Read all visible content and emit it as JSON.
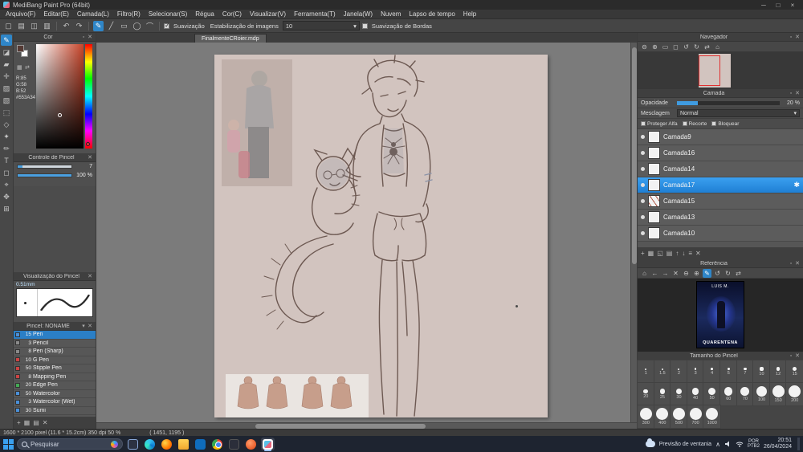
{
  "window": {
    "title": "MediBang Paint Pro (64bit)"
  },
  "menubar": [
    "Arquivo(F)",
    "Editar(E)",
    "Camada(L)",
    "Filtro(R)",
    "Selecionar(S)",
    "Régua",
    "Cor(C)",
    "Visualizar(V)",
    "Ferramenta(T)",
    "Janela(W)",
    "Nuvem",
    "Lapso de tempo",
    "Help"
  ],
  "toolbar": {
    "smoothing": "Suavização",
    "stabilization_label": "Estabilização de imagens",
    "stabilization_value": "10",
    "edge_smoothing": "Suavização de Bordas"
  },
  "color_panel": {
    "title": "Cor",
    "r": "R:85",
    "g": "G:58",
    "b": "B:52",
    "hex": "#553A34",
    "foreground": "#553A34",
    "background": "#FFFFFF"
  },
  "brush_control": {
    "title": "Controle de Pincel",
    "size": "7",
    "opacity": "100 %"
  },
  "brush_preview": {
    "title": "Visualização do Pincel",
    "size_label": "0.51mm"
  },
  "brush_list": {
    "title": "Pincel: NONAME",
    "items": [
      {
        "num": "15",
        "name": "Pen",
        "color": "#4a90d9",
        "selected": true
      },
      {
        "num": "3",
        "name": "Pencil",
        "color": "#8a8a8a",
        "selected": false
      },
      {
        "num": "8",
        "name": "Pen (Sharp)",
        "color": "#8a8a8a",
        "selected": false
      },
      {
        "num": "10",
        "name": "G Pen",
        "color": "#cc4444",
        "selected": false
      },
      {
        "num": "50",
        "name": "Stipple Pen",
        "color": "#cc4444",
        "selected": false
      },
      {
        "num": "8",
        "name": "Mapping Pen",
        "color": "#cc4444",
        "selected": false
      },
      {
        "num": "20",
        "name": "Edge Pen",
        "color": "#44aa55",
        "selected": false
      },
      {
        "num": "50",
        "name": "Watercolor",
        "color": "#4a90d9",
        "selected": false
      },
      {
        "num": "3",
        "name": "Watercolor (Wet)",
        "color": "#4a90d9",
        "selected": false
      },
      {
        "num": "30",
        "name": "Sumi",
        "color": "#4a90d9",
        "selected": false
      }
    ]
  },
  "canvas": {
    "tab": "FinalmenteCRoier.mdp"
  },
  "navigator": {
    "title": "Navegador"
  },
  "layer_panel": {
    "title": "Camada",
    "opacity_label": "Opacidade",
    "opacity_value": "20 %",
    "blend_label": "Mesclagem",
    "blend_value": "Normal",
    "protect_alpha": "Proteger Alfa",
    "clipping": "Recorte",
    "lock": "Bloquear",
    "accent": "#2f8fd8",
    "layers": [
      {
        "name": "Camada9",
        "selected": false,
        "thumb": "plain"
      },
      {
        "name": "Camada16",
        "selected": false,
        "thumb": "plain"
      },
      {
        "name": "Camada14",
        "selected": false,
        "thumb": "plain"
      },
      {
        "name": "Camada17",
        "selected": true,
        "thumb": "plain"
      },
      {
        "name": "Camada15",
        "selected": false,
        "thumb": "sketch"
      },
      {
        "name": "Camada13",
        "selected": false,
        "thumb": "plain"
      },
      {
        "name": "Camada10",
        "selected": false,
        "thumb": "plain"
      }
    ]
  },
  "reference_panel": {
    "title": "Referência",
    "poster_top": "LUIS M.",
    "poster_title": "QUARENTENA"
  },
  "brush_size_panel": {
    "title": "Tamanho do Pincel",
    "sizes": [
      "1",
      "1.5",
      "2",
      "3",
      "4",
      "5",
      "7",
      "10",
      "12",
      "15",
      "20",
      "25",
      "30",
      "40",
      "50",
      "60",
      "70",
      "100",
      "150",
      "200",
      "300",
      "400",
      "500",
      "700",
      "1000"
    ]
  },
  "statusbar": {
    "info": "1600 * 2100 pixel  (11.6 * 15.2cm)   350 dpi   50 %",
    "coords": "( 1451, 1195 )"
  },
  "taskbar": {
    "search_placeholder": "Pesquisar",
    "weather": "Previsão de ventania",
    "lang_top": "POR",
    "lang_bottom": "PTB2",
    "time": "20:51",
    "date": "26/04/2024"
  }
}
